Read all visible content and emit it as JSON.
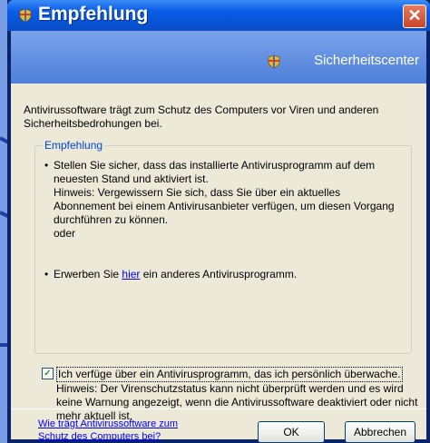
{
  "window": {
    "title": "Empfehlung",
    "close_glyph": "✕"
  },
  "header": {
    "label": "Sicherheitscenter"
  },
  "intro": "Antivirussoftware trägt zum Schutz des Computers vor Viren und anderen Sicherheitsbedrohungen bei.",
  "group": {
    "label": "Empfehlung",
    "bullet1": "Stellen Sie sicher, dass das installierte Antivirusprogramm auf dem neuesten Stand und aktiviert ist.",
    "bullet1_note": "Hinweis: Vergewissern Sie sich, dass Sie über ein aktuelles Abonnement bei einem Antivirusanbieter verfügen, um diesen Vorgang durchführen zu können.",
    "or": "oder",
    "bullet2_pre": "Erwerben Sie",
    "bullet2_link": "hier",
    "bullet2_post": "ein anderes Antivirusprogramm."
  },
  "checkbox": {
    "label": "Ich verfüge über ein Antivirusprogramm, das ich persönlich überwache.",
    "note": "Hinweis: Der Virenschutzstatus kann nicht überprüft werden und es wird keine Warnung angezeigt, wenn die Antivirussoftware deaktiviert oder nicht mehr aktuell ist.",
    "checked": true
  },
  "footer": {
    "link": "Wie trägt Antivirussoftware zum Schutz des Computers bei?",
    "ok": "OK",
    "cancel": "Abbrechen"
  },
  "icons": {
    "title": "shield-icon",
    "header": "shield-icon"
  },
  "colors": {
    "titlebar": "#0653d6",
    "client": "#ece9d8",
    "header": "#5a86dc",
    "link": "#0000ff",
    "group_label": "#0046d5"
  }
}
